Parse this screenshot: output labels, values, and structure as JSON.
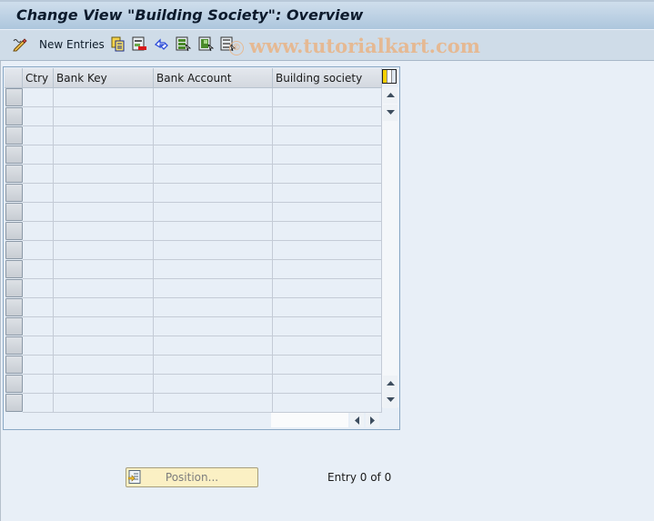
{
  "window": {
    "title": "Change View \"Building Society\": Overview"
  },
  "toolbar": {
    "new_entries_label": "New Entries",
    "icons": [
      "display-change-icon",
      "copy-icon",
      "delete-icon",
      "undo-icon",
      "select-all-icon",
      "select-block-icon",
      "deselect-all-icon"
    ],
    "watermark": "www.tutorialkart.com",
    "watermark_symbol": "©"
  },
  "table": {
    "columns": [
      {
        "label": "Ctry"
      },
      {
        "label": "Bank Key"
      },
      {
        "label": "Bank Account"
      },
      {
        "label": "Building society"
      }
    ],
    "rows": [
      [
        "",
        "",
        "",
        ""
      ],
      [
        "",
        "",
        "",
        ""
      ],
      [
        "",
        "",
        "",
        ""
      ],
      [
        "",
        "",
        "",
        ""
      ],
      [
        "",
        "",
        "",
        ""
      ],
      [
        "",
        "",
        "",
        ""
      ],
      [
        "",
        "",
        "",
        ""
      ],
      [
        "",
        "",
        "",
        ""
      ],
      [
        "",
        "",
        "",
        ""
      ],
      [
        "",
        "",
        "",
        ""
      ],
      [
        "",
        "",
        "",
        ""
      ],
      [
        "",
        "",
        "",
        ""
      ],
      [
        "",
        "",
        "",
        ""
      ],
      [
        "",
        "",
        "",
        ""
      ],
      [
        "",
        "",
        "",
        ""
      ],
      [
        "",
        "",
        "",
        ""
      ],
      [
        "",
        "",
        "",
        ""
      ]
    ]
  },
  "footer": {
    "position_button_label": "Position...",
    "entry_status": "Entry 0 of 0"
  },
  "colors": {
    "position_button_bg": "#fbf0c4",
    "watermark": "#e8b68a"
  }
}
